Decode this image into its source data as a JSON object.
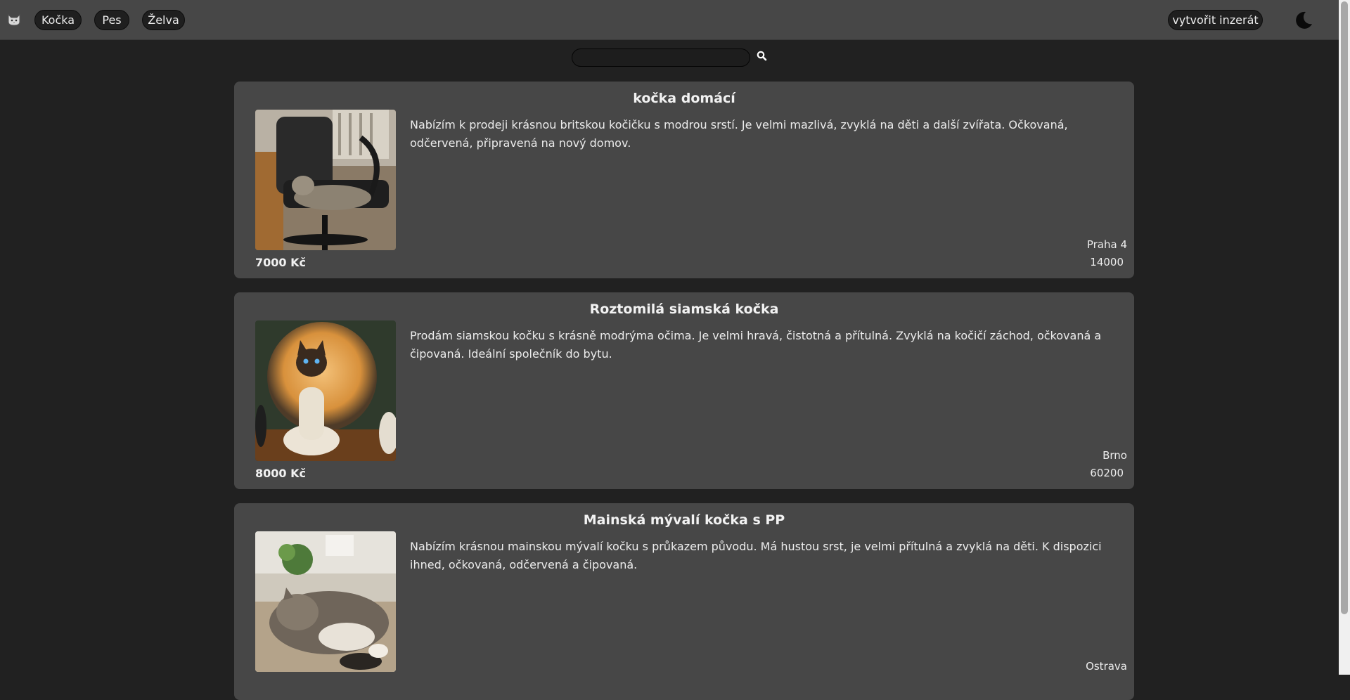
{
  "nav": {
    "logo_icon": "cat-face-icon",
    "categories": [
      {
        "label": "Kočka"
      },
      {
        "label": "Pes"
      },
      {
        "label": "Želva"
      }
    ],
    "create_label": "vytvořit inzerát",
    "theme_icon": "moon-icon"
  },
  "search": {
    "value": "",
    "placeholder": "",
    "icon": "search-icon"
  },
  "listings": [
    {
      "title": "kočka domácí",
      "description": "Nabízím k prodeji krásnou britskou kočičku s modrou srstí. Je velmi mazlivá, zvyklá na děti a další zvířata. Očkovaná, odčervená, připravená na nový domov.",
      "price": "7000 Kč",
      "city": "Praha 4",
      "zip": "14000"
    },
    {
      "title": "Roztomilá siamská kočka",
      "description": "Prodám siamskou kočku s krásně modrýma očima. Je velmi hravá, čistotná a přítulná. Zvyklá na kočičí záchod, očkovaná a čipovaná. Ideální společník do bytu.",
      "price": "8000 Kč",
      "city": "Brno",
      "zip": "60200"
    },
    {
      "title": "Mainská mývalí kočka s PP",
      "description": "Nabízím krásnou mainskou mývalí kočku s průkazem původu. Má hustou srst, je velmi přítulná a zvyklá na děti. K dispozici ihned, očkovaná, odčervená a čipovaná.",
      "price": "",
      "city": "Ostrava",
      "zip": ""
    }
  ],
  "colors": {
    "page_bg": "#212121",
    "card_bg": "#474747",
    "topbar_bg": "#474747",
    "pill_bg": "#1f1f1f"
  }
}
